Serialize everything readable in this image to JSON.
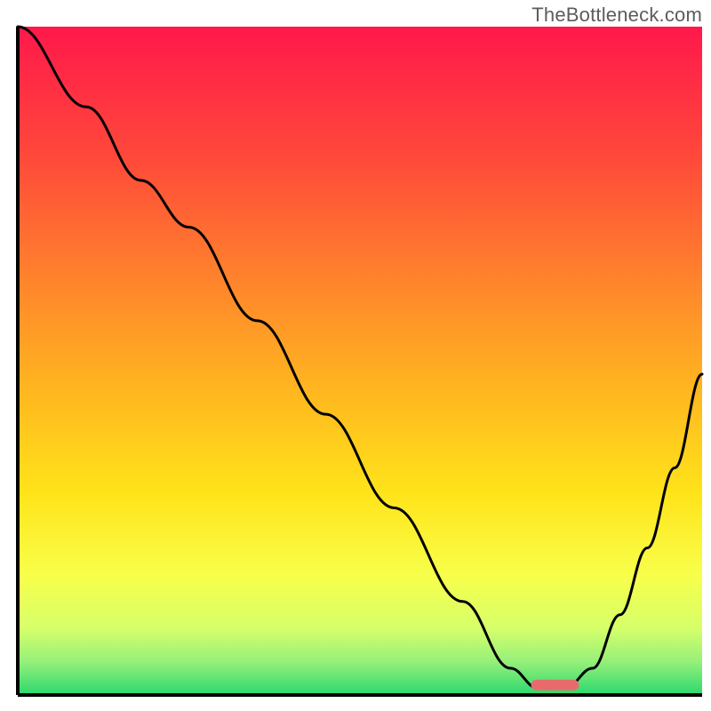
{
  "watermark": "TheBottleneck.com",
  "chart_data": {
    "type": "line",
    "title": "",
    "xlabel": "",
    "ylabel": "",
    "xlim": [
      0,
      100
    ],
    "ylim": [
      0,
      100
    ],
    "series": [
      {
        "name": "curve",
        "x": [
          0,
          10,
          18,
          25,
          35,
          45,
          55,
          65,
          72,
          76,
          80,
          84,
          88,
          92,
          96,
          100
        ],
        "y": [
          100,
          88,
          77,
          70,
          56,
          42,
          28,
          14,
          4,
          1,
          1,
          4,
          12,
          22,
          34,
          48
        ]
      }
    ],
    "sweet_spot": {
      "x_start": 75,
      "x_end": 82,
      "y": 1.5
    },
    "gradient_stops": [
      {
        "offset": 0,
        "color": "#ff184b"
      },
      {
        "offset": 20,
        "color": "#ff4a3a"
      },
      {
        "offset": 40,
        "color": "#ff8a2a"
      },
      {
        "offset": 55,
        "color": "#ffb81f"
      },
      {
        "offset": 70,
        "color": "#ffe41a"
      },
      {
        "offset": 82,
        "color": "#f8ff4a"
      },
      {
        "offset": 90,
        "color": "#d6ff6a"
      },
      {
        "offset": 95,
        "color": "#96f07a"
      },
      {
        "offset": 100,
        "color": "#2bd86f"
      }
    ],
    "axes_color": "#000000",
    "line_color": "#000000",
    "sweet_spot_color": "#e86b6b"
  }
}
